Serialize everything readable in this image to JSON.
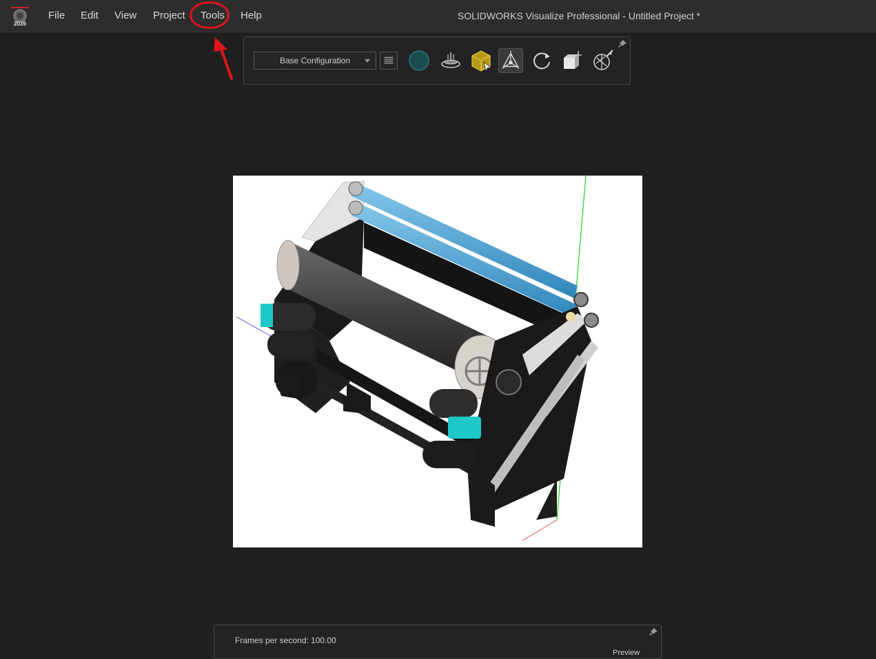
{
  "menubar": {
    "logo_badge": "2026",
    "items": [
      {
        "label": "File"
      },
      {
        "label": "Edit"
      },
      {
        "label": "View"
      },
      {
        "label": "Project"
      },
      {
        "label": "Tools"
      },
      {
        "label": "Help"
      }
    ],
    "window_title": "SOLIDWORKS Visualize Professional - Untitled Project *"
  },
  "toolbar": {
    "configuration": "Base Configuration",
    "icons": [
      "environment-sphere-icon",
      "turntable-icon",
      "select-model-icon",
      "transform-gizmo-icon",
      "reset-rotate-icon",
      "camera-frame-icon",
      "render-effects-icon"
    ]
  },
  "status_panel": {
    "fps_label": "Frames per second: 100.00",
    "preview_label": "Preview"
  },
  "colors": {
    "accent": "#e0141b",
    "background": "#1f1f1f",
    "menubar": "#2d2d2d",
    "roller_blue": "#4aa3d6",
    "teal": "#1fc8c8"
  }
}
